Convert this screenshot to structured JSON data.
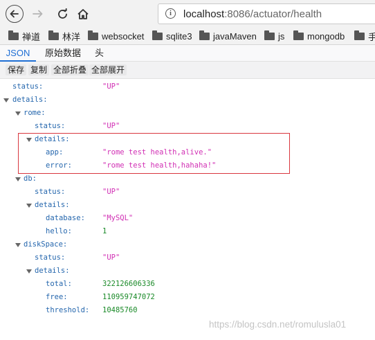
{
  "browser": {
    "url_host": "localhost",
    "url_rest": ":8086/actuator/health"
  },
  "bookmarks": [
    "禅道",
    "林洋",
    "websocket",
    "sqlite3",
    "javaMaven",
    "js",
    "mongodb",
    "手"
  ],
  "viewer": {
    "tabs": [
      "JSON",
      "原始数据",
      "头"
    ],
    "toolbar": [
      "保存",
      "复制",
      "全部折叠",
      "全部展开"
    ]
  },
  "json": {
    "status_key": "status:",
    "status_val": "\"UP\"",
    "details_key": "details:",
    "rome_key": "rome:",
    "rome_status_key": "status:",
    "rome_status_val": "\"UP\"",
    "rome_details_key": "details:",
    "rome_app_key": "app:",
    "rome_app_val": "\"rome test health,alive.\"",
    "rome_error_key": "error:",
    "rome_error_val": "\"rome test health,hahaha!\"",
    "db_key": "db:",
    "db_status_key": "status:",
    "db_status_val": "\"UP\"",
    "db_details_key": "details:",
    "db_database_key": "database:",
    "db_database_val": "\"MySQL\"",
    "db_hello_key": "hello:",
    "db_hello_val": "1",
    "disk_key": "diskSpace:",
    "disk_status_key": "status:",
    "disk_status_val": "\"UP\"",
    "disk_details_key": "details:",
    "disk_total_key": "total:",
    "disk_total_val": "322126606336",
    "disk_free_key": "free:",
    "disk_free_val": "110959747072",
    "disk_threshold_key": "threshold:",
    "disk_threshold_val": "10485760"
  },
  "watermark": "https://blog.csdn.net/romulusla01",
  "colors": {
    "key": "#2466ad",
    "string": "#d12fb4",
    "number": "#1a8a28",
    "highlight_border": "#d9363e",
    "active_tab": "#1f6fd4"
  }
}
